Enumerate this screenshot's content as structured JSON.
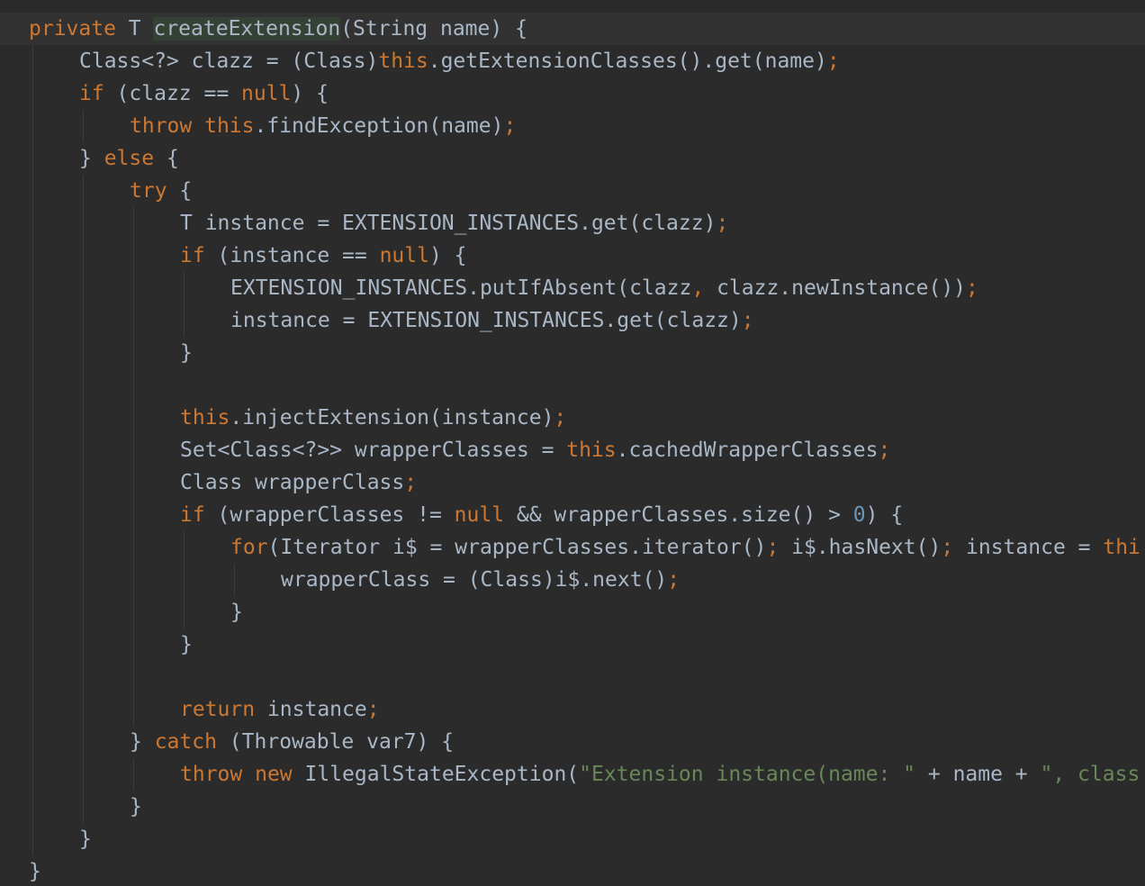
{
  "editor": {
    "theme_colors": {
      "background": "#2b2b2b",
      "current_line": "#323232",
      "text": "#a9b7c6",
      "keyword": "#cc7832",
      "string": "#6a8759",
      "number": "#6897bb"
    },
    "lines": [
      {
        "indent": 0,
        "current": true,
        "tokens": [
          {
            "t": "private",
            "c": "kw"
          },
          {
            "t": " T ",
            "c": "plain"
          },
          {
            "t": "createExtension",
            "c": "fn-hl"
          },
          {
            "t": "(String name) {",
            "c": "plain"
          }
        ]
      },
      {
        "indent": 1,
        "tokens": [
          {
            "t": "Class<?> clazz = (Class)",
            "c": "plain"
          },
          {
            "t": "this",
            "c": "kw"
          },
          {
            "t": ".getExtensionClasses().get(name)",
            "c": "plain"
          },
          {
            "t": ";",
            "c": "sym"
          }
        ]
      },
      {
        "indent": 1,
        "tokens": [
          {
            "t": "if",
            "c": "kw"
          },
          {
            "t": " (clazz == ",
            "c": "plain"
          },
          {
            "t": "null",
            "c": "kw"
          },
          {
            "t": ") {",
            "c": "plain"
          }
        ]
      },
      {
        "indent": 2,
        "tokens": [
          {
            "t": "throw",
            "c": "kw"
          },
          {
            "t": " ",
            "c": "plain"
          },
          {
            "t": "this",
            "c": "kw"
          },
          {
            "t": ".findException(name)",
            "c": "plain"
          },
          {
            "t": ";",
            "c": "sym"
          }
        ]
      },
      {
        "indent": 1,
        "tokens": [
          {
            "t": "} ",
            "c": "plain"
          },
          {
            "t": "else",
            "c": "kw"
          },
          {
            "t": " {",
            "c": "plain"
          }
        ]
      },
      {
        "indent": 2,
        "tokens": [
          {
            "t": "try",
            "c": "kw"
          },
          {
            "t": " {",
            "c": "plain"
          }
        ]
      },
      {
        "indent": 3,
        "tokens": [
          {
            "t": "T instance = EXTENSION_INSTANCES.get(clazz)",
            "c": "plain"
          },
          {
            "t": ";",
            "c": "sym"
          }
        ]
      },
      {
        "indent": 3,
        "tokens": [
          {
            "t": "if",
            "c": "kw"
          },
          {
            "t": " (instance == ",
            "c": "plain"
          },
          {
            "t": "null",
            "c": "kw"
          },
          {
            "t": ") {",
            "c": "plain"
          }
        ]
      },
      {
        "indent": 4,
        "tokens": [
          {
            "t": "EXTENSION_INSTANCES.putIfAbsent(clazz",
            "c": "plain"
          },
          {
            "t": ",",
            "c": "sym"
          },
          {
            "t": " clazz.newInstance())",
            "c": "plain"
          },
          {
            "t": ";",
            "c": "sym"
          }
        ]
      },
      {
        "indent": 4,
        "tokens": [
          {
            "t": "instance = EXTENSION_INSTANCES.get(clazz)",
            "c": "plain"
          },
          {
            "t": ";",
            "c": "sym"
          }
        ]
      },
      {
        "indent": 3,
        "tokens": [
          {
            "t": "}",
            "c": "plain"
          }
        ]
      },
      {
        "indent": 0,
        "tokens": []
      },
      {
        "indent": 3,
        "tokens": [
          {
            "t": "this",
            "c": "kw"
          },
          {
            "t": ".injectExtension(instance)",
            "c": "plain"
          },
          {
            "t": ";",
            "c": "sym"
          }
        ]
      },
      {
        "indent": 3,
        "tokens": [
          {
            "t": "Set<Class<?>> wrapperClasses = ",
            "c": "plain"
          },
          {
            "t": "this",
            "c": "kw"
          },
          {
            "t": ".cachedWrapperClasses",
            "c": "plain"
          },
          {
            "t": ";",
            "c": "sym"
          }
        ]
      },
      {
        "indent": 3,
        "tokens": [
          {
            "t": "Class wrapperClass",
            "c": "plain"
          },
          {
            "t": ";",
            "c": "sym"
          }
        ]
      },
      {
        "indent": 3,
        "tokens": [
          {
            "t": "if",
            "c": "kw"
          },
          {
            "t": " (wrapperClasses != ",
            "c": "plain"
          },
          {
            "t": "null",
            "c": "kw"
          },
          {
            "t": " && wrapperClasses.size() > ",
            "c": "plain"
          },
          {
            "t": "0",
            "c": "num"
          },
          {
            "t": ") {",
            "c": "plain"
          }
        ]
      },
      {
        "indent": 4,
        "tokens": [
          {
            "t": "for",
            "c": "kw"
          },
          {
            "t": "(Iterator i$ = wrapperClasses.iterator()",
            "c": "plain"
          },
          {
            "t": ";",
            "c": "sym"
          },
          {
            "t": " i$.hasNext()",
            "c": "plain"
          },
          {
            "t": ";",
            "c": "sym"
          },
          {
            "t": " instance = ",
            "c": "plain"
          },
          {
            "t": "thi",
            "c": "kw"
          }
        ]
      },
      {
        "indent": 5,
        "tokens": [
          {
            "t": "wrapperClass = (Class)i$.next()",
            "c": "plain"
          },
          {
            "t": ";",
            "c": "sym"
          }
        ]
      },
      {
        "indent": 4,
        "tokens": [
          {
            "t": "}",
            "c": "plain"
          }
        ]
      },
      {
        "indent": 3,
        "tokens": [
          {
            "t": "}",
            "c": "plain"
          }
        ]
      },
      {
        "indent": 0,
        "tokens": []
      },
      {
        "indent": 3,
        "tokens": [
          {
            "t": "return",
            "c": "kw"
          },
          {
            "t": " instance",
            "c": "plain"
          },
          {
            "t": ";",
            "c": "sym"
          }
        ]
      },
      {
        "indent": 2,
        "tokens": [
          {
            "t": "} ",
            "c": "plain"
          },
          {
            "t": "catch",
            "c": "kw"
          },
          {
            "t": " (Throwable var7) {",
            "c": "plain"
          }
        ]
      },
      {
        "indent": 3,
        "tokens": [
          {
            "t": "throw",
            "c": "kw"
          },
          {
            "t": " ",
            "c": "plain"
          },
          {
            "t": "new",
            "c": "kw"
          },
          {
            "t": " IllegalStateException(",
            "c": "plain"
          },
          {
            "t": "\"Extension instance(name: \"",
            "c": "str"
          },
          {
            "t": " + name + ",
            "c": "plain"
          },
          {
            "t": "\", class",
            "c": "str"
          }
        ]
      },
      {
        "indent": 2,
        "tokens": [
          {
            "t": "}",
            "c": "plain"
          }
        ]
      },
      {
        "indent": 1,
        "tokens": [
          {
            "t": "}",
            "c": "plain"
          }
        ]
      },
      {
        "indent": 0,
        "tokens": [
          {
            "t": "}",
            "c": "plain"
          }
        ]
      }
    ]
  }
}
